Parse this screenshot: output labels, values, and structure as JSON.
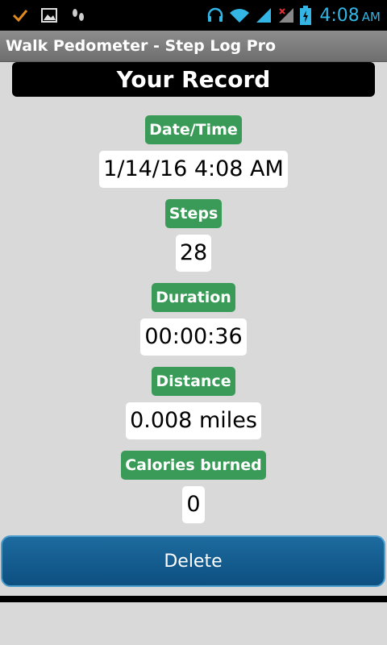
{
  "status_bar": {
    "time": "4:08",
    "ampm": "AM",
    "left_icons": [
      "checkmark-icon",
      "image-icon",
      "footprints-icon"
    ],
    "right_icons": [
      "headset-icon",
      "wifi-icon",
      "signal-icon",
      "signal-no-data-icon",
      "battery-charging-icon"
    ]
  },
  "title_bar": {
    "title": "Walk Pedometer - Step Log Pro"
  },
  "header": {
    "title": "Your Record"
  },
  "fields": [
    {
      "label": "Date/Time",
      "value": "1/14/16 4:08 AM"
    },
    {
      "label": "Steps",
      "value": "28"
    },
    {
      "label": "Duration",
      "value": "00:00:36"
    },
    {
      "label": "Distance",
      "value": "0.008 miles"
    },
    {
      "label": "Calories burned",
      "value": "0"
    }
  ],
  "actions": {
    "delete_label": "Delete"
  },
  "colors": {
    "label_bg": "#3a9b58",
    "button_bg": "#1d6b9f",
    "status_accent": "#33b5e5",
    "background": "#d9d9d9"
  }
}
